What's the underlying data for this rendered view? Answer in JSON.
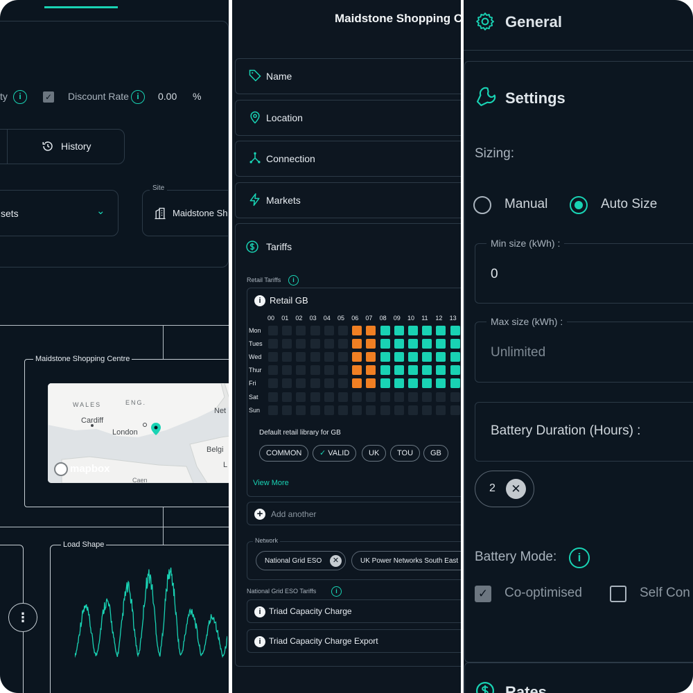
{
  "panel_left": {
    "discount": {
      "prev_label_fragment": "ty",
      "label": "Discount Rate",
      "value": "0.00",
      "unit": "%"
    },
    "history_label": "History",
    "assets_select_fragment": "sets",
    "site": {
      "legend": "Site",
      "value": "Maidstone Sh"
    },
    "map_card": {
      "title": "Maidstone Shopping Centre",
      "places": [
        "WALES",
        "ENG.",
        "Cardiff",
        "London",
        "Net",
        "Belgi",
        "L",
        "Caen"
      ],
      "brand": "mapbox"
    },
    "load_shape": {
      "title": "Load Shape"
    }
  },
  "panel_middle": {
    "header_title": "Maidstone Shopping C",
    "sections": [
      {
        "label": "Name",
        "icon": "tag-icon"
      },
      {
        "label": "Location",
        "icon": "pin-icon"
      },
      {
        "label": "Connection",
        "icon": "connection-icon"
      },
      {
        "label": "Markets",
        "icon": "bolt-icon"
      }
    ],
    "tariffs": {
      "label": "Tariffs",
      "retail_label": "Retail Tariffs",
      "retail_card": {
        "title": "Retail GB",
        "hours": [
          "00",
          "01",
          "02",
          "03",
          "04",
          "05",
          "06",
          "07",
          "08",
          "09",
          "10",
          "11",
          "12",
          "13"
        ],
        "days": [
          "Mon",
          "Tues",
          "Wed",
          "Thur",
          "Fri",
          "Sat",
          "Sun"
        ],
        "grid_rows": [
          "______OOTTTTTT",
          "______OOTTTTTT",
          "______OOTTTTTT",
          "______OOTTTTTT",
          "______OOTTTTTT",
          "______________",
          "______________"
        ],
        "description": "Default retail library for GB",
        "tags": [
          "COMMON",
          "VALID",
          "UK",
          "TOU",
          "GB"
        ],
        "view_more": "View More"
      },
      "add_another": "Add another",
      "network": {
        "legend": "Network",
        "chips": [
          "National Grid ESO",
          "UK Power Networks South East"
        ]
      },
      "ngeso_label": "National Grid ESO Tariffs",
      "ngeso_items": [
        "Triad Capacity Charge",
        "Triad Capacity Charge Export"
      ]
    },
    "colors": {
      "orange": "#f07f23",
      "teal": "#19d3b4",
      "empty": "#1b2631"
    }
  },
  "panel_right": {
    "general": "General",
    "settings": "Settings",
    "sizing_label": "Sizing:",
    "sizing_options": [
      "Manual",
      "Auto Size"
    ],
    "sizing_selected": "Auto Size",
    "min_size": {
      "legend": "Min size (kWh) :",
      "value": "0"
    },
    "max_size": {
      "legend": "Max size (kWh) :",
      "placeholder": "Unlimited"
    },
    "battery_duration_label": "Battery Duration (Hours) :",
    "duration_chip": "2",
    "battery_mode_label": "Battery Mode:",
    "modes": [
      "Co-optimised",
      "Self Con"
    ],
    "modes_checked": [
      "Co-optimised"
    ],
    "rates": "Rates"
  }
}
